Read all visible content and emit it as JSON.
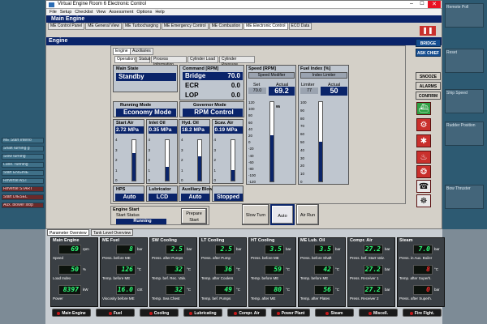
{
  "window": {
    "title": "Virtual Engine Room 6 Electronic Control"
  },
  "menu": [
    "File",
    "Setup",
    "Checklist",
    "View",
    "Assessment",
    "Options",
    "Help"
  ],
  "main_header": "Main Engine",
  "nav_tabs": [
    {
      "label": "ME Control Panel",
      "active": false
    },
    {
      "label": "ME General View",
      "active": false
    },
    {
      "label": "ME Turbocharging",
      "active": false
    },
    {
      "label": "ME Emergency Control",
      "active": false
    },
    {
      "label": "ME Combustion",
      "active": false
    },
    {
      "label": "ME Electronic Control",
      "active": true
    },
    {
      "label": "ECO Data",
      "active": false
    }
  ],
  "engine_header": "Engine",
  "engine_tabs": [
    "Engine",
    "Auxiliaries"
  ],
  "engine_subtabs": [
    "Operation",
    "Status",
    "Process Information",
    "Cylinder Load",
    "Cylinder Pressure"
  ],
  "main_state": {
    "label": "Main State",
    "value": "Standby"
  },
  "command": {
    "label": "Command [RPM]",
    "rows": [
      {
        "name": "Bridge",
        "value": "70.0"
      },
      {
        "name": "ECR",
        "value": "0.0"
      },
      {
        "name": "LOP",
        "value": "0.0"
      }
    ]
  },
  "running_mode": {
    "label": "Running Mode",
    "value": "Economy Mode"
  },
  "governor_mode": {
    "label": "Governor Mode",
    "value": "RPM Control"
  },
  "pressures": [
    {
      "label": "Start Air",
      "value": "2.72 MPa",
      "level": 0.68
    },
    {
      "label": "Inlet Oil",
      "value": "0.35 MPa",
      "level": 0.34
    },
    {
      "label": "Hyd. Oil",
      "value": "18.2 MPa",
      "level": 0.6
    },
    {
      "label": "Scav. Air",
      "value": "0.19 MPa",
      "level": 0.27
    }
  ],
  "pressure_ticks": [
    "4",
    "3",
    "2",
    "1",
    "0"
  ],
  "status_boxes": [
    {
      "label": "HPS",
      "value": "Auto"
    },
    {
      "label": "Lubricator",
      "value": "LCD"
    },
    {
      "label": "Auxiliary Blowers",
      "value": "Auto"
    },
    {
      "label": "",
      "value": "Stopped"
    }
  ],
  "speed": {
    "label": "Speed [RPM]",
    "modifier": "Speed Modifier",
    "set_label": "Set",
    "set_value": "70.0",
    "actual_label": "Actual",
    "actual_value": "69.2",
    "marker": "95",
    "level": 0.58,
    "ticks": [
      "120",
      "100",
      "80",
      "60",
      "40",
      "20",
      "0",
      "-20",
      "-40",
      "-60",
      "-80",
      "-100",
      "-120"
    ]
  },
  "fuel_index": {
    "label": "Fuel Index [%]",
    "limiter_label": "Index Limiter",
    "limiter_value_label": "Limiter",
    "limiter_value": "77",
    "actual_label": "Actual",
    "actual_value": "50",
    "level": 0.5,
    "ticks": [
      "100",
      "90",
      "80",
      "70",
      "60",
      "50",
      "40",
      "30",
      "20",
      "10",
      "0"
    ]
  },
  "engine_start": {
    "label": "Engine Start",
    "status_label": "Start Status",
    "status_value": "Running",
    "prepare_label": "Prepare Start"
  },
  "control_buttons": [
    "Slow Turn",
    "Auto",
    "Air Run"
  ],
  "side_buttons": [
    "BRIDGE",
    "ASK CHIEF",
    "SNOOZE",
    "ALARMS",
    "CONFIRM"
  ],
  "side_icons": [
    "ship-icon",
    "gear-alarm-icon",
    "engine-alarm-icon",
    "fire-icon",
    "co2-icon",
    "phone-icon",
    "captain-icon"
  ],
  "overview_tabs": [
    {
      "label": "Parameter Overview",
      "active": true
    },
    {
      "label": "Tank Level Overview",
      "active": false
    }
  ],
  "cards": [
    {
      "title": "Main Engine",
      "rows": [
        {
          "value": "69",
          "unit": "rpm",
          "label": "Speed",
          "red": false
        },
        {
          "value": "50",
          "unit": "%",
          "label": "Load Index",
          "red": false
        },
        {
          "value": "8397",
          "unit": "kW",
          "label": "Power",
          "red": false
        }
      ]
    },
    {
      "title": "ME Fuel",
      "rows": [
        {
          "value": "8",
          "unit": "bar",
          "label": "Press. before ME",
          "red": false
        },
        {
          "value": "126",
          "unit": "°C",
          "label": "Temp. before ME",
          "red": false
        },
        {
          "value": "16.0",
          "unit": "cSt",
          "label": "Viscosity before ME",
          "red": false
        }
      ]
    },
    {
      "title": "SW Cooling",
      "rows": [
        {
          "value": "2.5",
          "unit": "bar",
          "label": "Press. after Pumps",
          "red": false
        },
        {
          "value": "32",
          "unit": "°C",
          "label": "Temp. bef. Rec. Valv.",
          "red": false
        },
        {
          "value": "32",
          "unit": "°C",
          "label": "Temp. Sea Chest",
          "red": false
        }
      ]
    },
    {
      "title": "LT Cooling",
      "rows": [
        {
          "value": "2.5",
          "unit": "bar",
          "label": "Press. after Pump",
          "red": false
        },
        {
          "value": "36",
          "unit": "°C",
          "label": "Temp. after Coolers",
          "red": false
        },
        {
          "value": "49",
          "unit": "°C",
          "label": "Temp. bef. Pumps",
          "red": false
        }
      ]
    },
    {
      "title": "HT Cooling",
      "rows": [
        {
          "value": "3.5",
          "unit": "bar",
          "label": "Press. before ME",
          "red": false
        },
        {
          "value": "59",
          "unit": "°C",
          "label": "Temp. before ME",
          "red": false
        },
        {
          "value": "80",
          "unit": "°C",
          "label": "Temp. after ME",
          "red": false
        }
      ]
    },
    {
      "title": "ME Lub. Oil",
      "rows": [
        {
          "value": "3.5",
          "unit": "bar",
          "label": "Press. before Shaft",
          "red": false
        },
        {
          "value": "42",
          "unit": "°C",
          "label": "Temp. before ME",
          "red": false
        },
        {
          "value": "56",
          "unit": "°C",
          "label": "Temp. after Plates",
          "red": false
        }
      ]
    },
    {
      "title": "Compr. Air",
      "rows": [
        {
          "value": "27.2",
          "unit": "bar",
          "label": "Press. bef. Start Valv.",
          "red": false
        },
        {
          "value": "27.2",
          "unit": "bar",
          "label": "Press. Receiver 1",
          "red": false
        },
        {
          "value": "27.2",
          "unit": "bar",
          "label": "Press. Receiver 2",
          "red": false
        }
      ]
    },
    {
      "title": "Steam",
      "rows": [
        {
          "value": "7.0",
          "unit": "bar",
          "label": "Press. in Aux. Boiler",
          "red": false
        },
        {
          "value": "8",
          "unit": "°C",
          "label": "Temp. after Superh.",
          "red": true
        },
        {
          "value": "0",
          "unit": "bar",
          "label": "Press. after Superh.",
          "red": true
        }
      ]
    }
  ],
  "category_buttons": [
    "Main Engine",
    "Fuel",
    "Cooling",
    "Lubricating",
    "Compr. Air",
    "Power Plant",
    "Steam",
    "Miscell.",
    "Fire Fight."
  ],
  "background_left": [
    "ME Start Interlo",
    "Shaft turning g",
    "Slow turning",
    "Lube. running",
    "Start ENGINE",
    "Reverse AST",
    "Reverse START",
    "Start DIESEL",
    "Aux. blower stop"
  ],
  "background_right": [
    "Remote Poll",
    "Flash",
    "Reset",
    "Press Valve",
    "Ship Speed",
    "Rudder Position",
    "Bow Thruster"
  ]
}
